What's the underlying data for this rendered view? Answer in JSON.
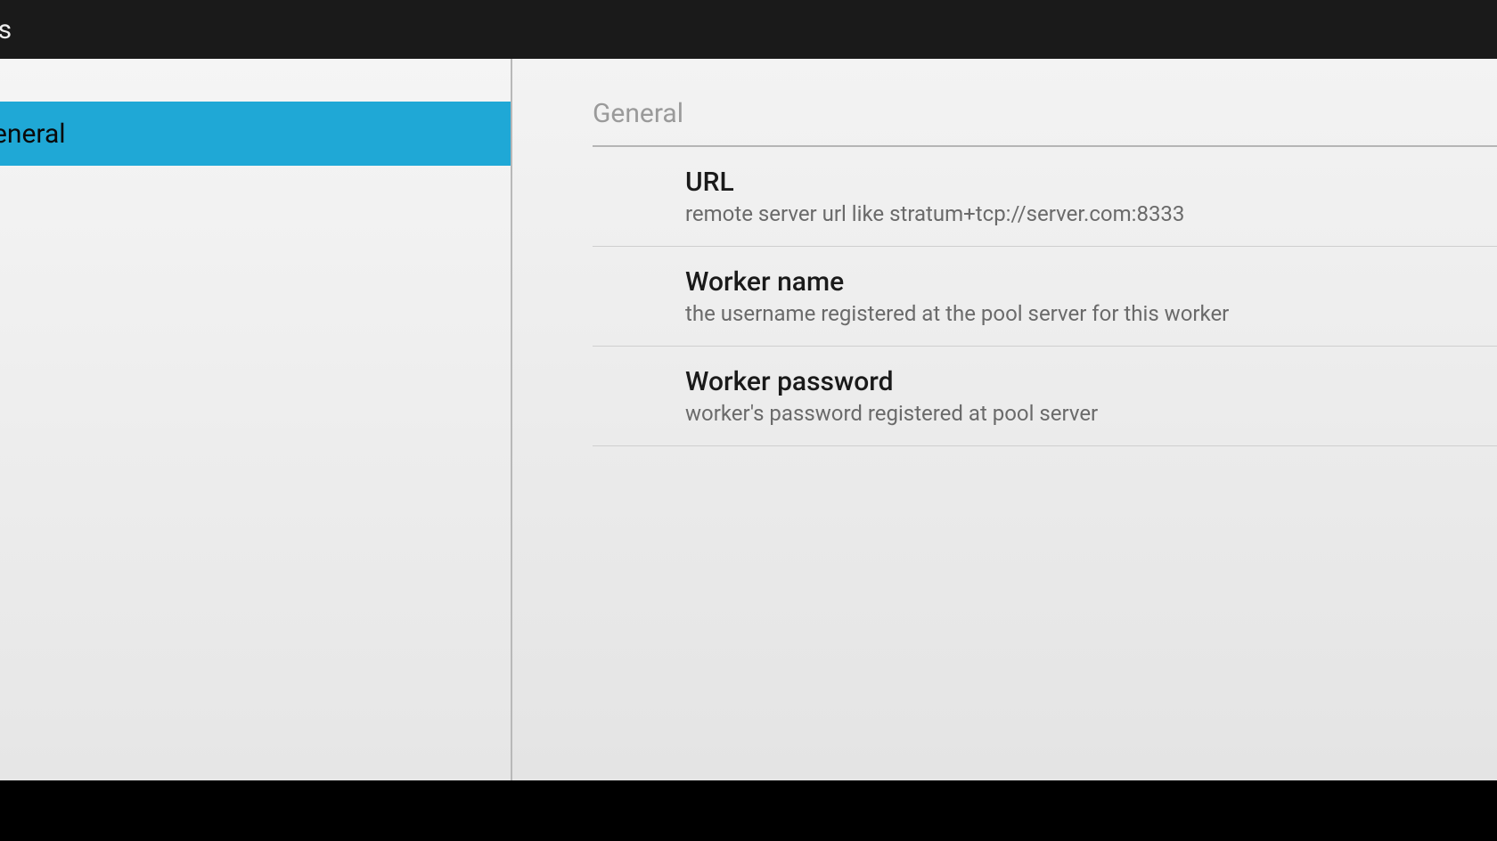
{
  "actionbar": {
    "title_fragment": "js"
  },
  "sidebar": {
    "items": [
      {
        "label": "eneral",
        "selected": true
      }
    ]
  },
  "content": {
    "section_header": "General",
    "prefs": [
      {
        "title": "URL",
        "summary": "remote server url like stratum+tcp://server.com:8333"
      },
      {
        "title": "Worker name",
        "summary": "the username registered at the pool server for this worker"
      },
      {
        "title": "Worker password",
        "summary": "worker's password registered at pool server"
      }
    ]
  }
}
